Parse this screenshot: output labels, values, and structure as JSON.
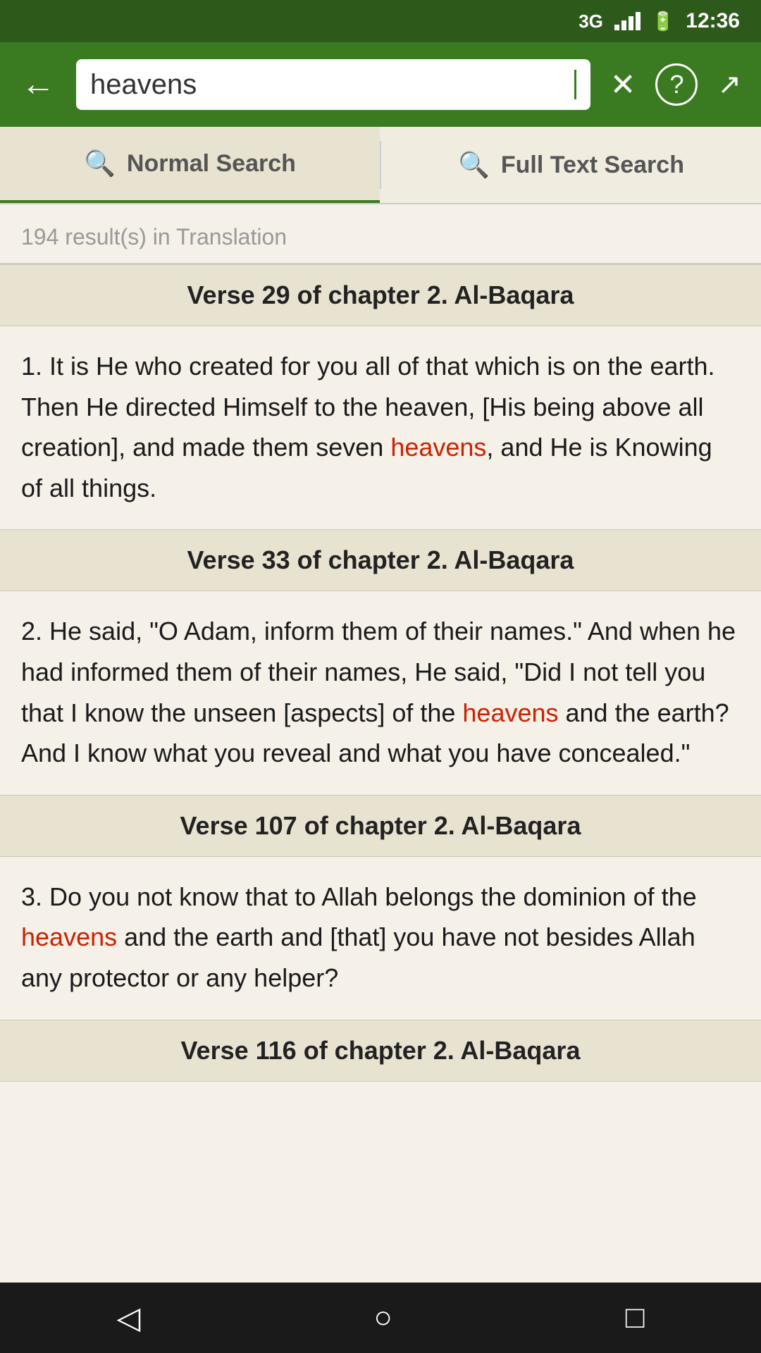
{
  "statusBar": {
    "signal": "3G",
    "time": "12:36",
    "batteryIcon": "🔋"
  },
  "header": {
    "searchValue": "heavens",
    "backIcon": "←",
    "clearIcon": "✕",
    "helpIcon": "?",
    "shareIcon": "⎘"
  },
  "tabs": [
    {
      "id": "normal",
      "label": "Normal Search",
      "active": true
    },
    {
      "id": "fulltext",
      "label": "Full Text Search",
      "active": false
    }
  ],
  "resultsCount": "194 result(s) in Translation",
  "verses": [
    {
      "header": "Verse 29 of chapter 2. Al-Baqara",
      "number": "1",
      "textParts": [
        {
          "text": "1. It is He who created for you all of that which is on the earth. Then He directed Himself to the heaven, [His being above all creation], and made them seven ",
          "highlight": false
        },
        {
          "text": "heavens",
          "highlight": true
        },
        {
          "text": ", and He is Knowing of all things.",
          "highlight": false
        }
      ]
    },
    {
      "header": "Verse 33 of chapter 2. Al-Baqara",
      "number": "2",
      "textParts": [
        {
          "text": "2. He said, \"O Adam, inform them of their names.\" And when he had informed them of their names, He said, \"Did I not tell you that I know the unseen [aspects] of the ",
          "highlight": false
        },
        {
          "text": "heavens",
          "highlight": true
        },
        {
          "text": " and the earth? And I know what you reveal and what you have concealed.\"",
          "highlight": false
        }
      ]
    },
    {
      "header": "Verse 107 of chapter 2. Al-Baqara",
      "number": "3",
      "textParts": [
        {
          "text": "3. Do you not know that to Allah belongs the dominion of the ",
          "highlight": false
        },
        {
          "text": "heavens",
          "highlight": true
        },
        {
          "text": " and the earth and [that] you have not besides Allah any protector or any helper?",
          "highlight": false
        }
      ]
    },
    {
      "header": "Verse 116 of chapter 2. Al-Baqara",
      "textParts": []
    }
  ],
  "bottomNav": {
    "backIcon": "◁",
    "homeIcon": "○",
    "recentIcon": "□"
  }
}
